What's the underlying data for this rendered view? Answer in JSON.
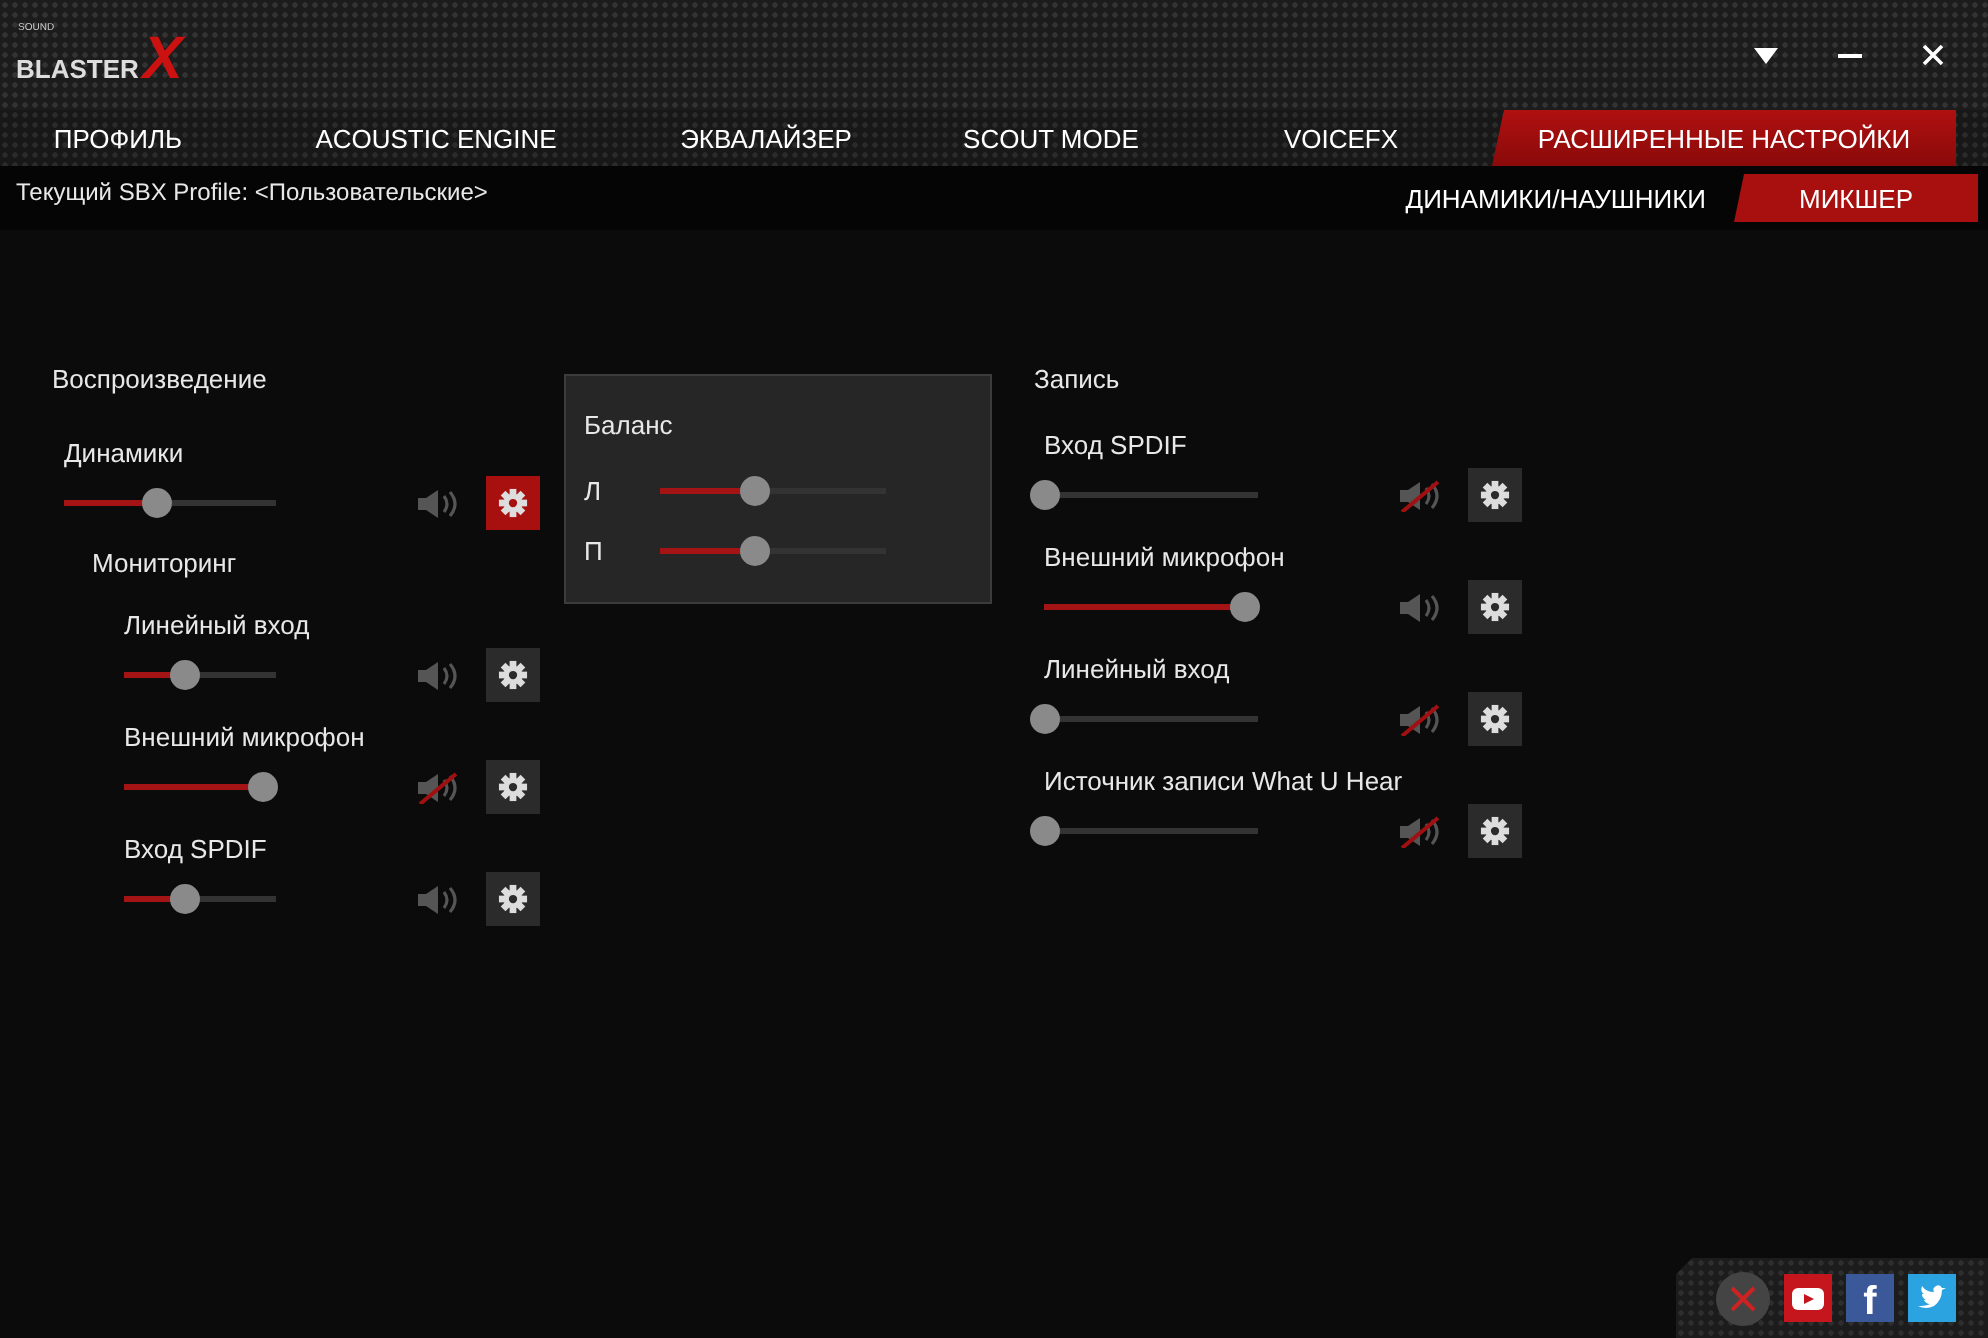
{
  "logo": {
    "small": "SOUND",
    "main": "BLASTER",
    "mark": "X"
  },
  "window_controls": [
    {
      "kind": "dropdown"
    },
    {
      "kind": "minimize"
    },
    {
      "kind": "close"
    }
  ],
  "tabs": [
    {
      "label": "ПРОФИЛЬ",
      "selected": false
    },
    {
      "label": "ACOUSTIC ENGINE",
      "selected": false
    },
    {
      "label": "ЭКВАЛАЙЗЕР",
      "selected": false
    },
    {
      "label": "SCOUT MODE",
      "selected": false
    },
    {
      "label": "VOICEFX",
      "selected": false
    },
    {
      "label": "РАСШИРЕННЫЕ НАСТРОЙКИ",
      "selected": true
    }
  ],
  "profile": "Текущий SBX Profile: <Пользовательские>",
  "subtabs": [
    {
      "label": "ДИНАМИКИ/НАУШНИКИ",
      "selected": false
    },
    {
      "label": "МИКШЕР",
      "selected": true
    }
  ],
  "playback": {
    "title": "Воспроизведение",
    "devices": [
      {
        "label": "Динамики",
        "level": 0.43,
        "muted": false,
        "settings_open": true
      }
    ],
    "monitoring": {
      "title": "Мониторинг",
      "devices": [
        {
          "label": "Линейный вход",
          "level": 0.39,
          "muted": false,
          "settings_open": false
        },
        {
          "label": "Внешний микрофон",
          "level": 0.91,
          "muted": true,
          "settings_open": false
        },
        {
          "label": "Вход SPDIF",
          "level": 0.39,
          "muted": false,
          "settings_open": false
        }
      ]
    }
  },
  "balance_popup": {
    "title": "Баланс",
    "channels": [
      {
        "label": "Л",
        "level": 0.42
      },
      {
        "label": "П",
        "level": 0.42
      }
    ]
  },
  "recording": {
    "title": "Запись",
    "devices": [
      {
        "label": "Вход SPDIF",
        "level": 0,
        "muted": true,
        "settings_open": false
      },
      {
        "label": "Внешний микрофон",
        "level": 0.93,
        "muted": false,
        "settings_open": false
      },
      {
        "label": "Линейный вход",
        "level": 0,
        "muted": true,
        "settings_open": false
      },
      {
        "label": "Источник записи What U Hear",
        "level": 0,
        "muted": true,
        "settings_open": false
      }
    ]
  },
  "social": [
    {
      "kind": "close"
    },
    {
      "kind": "youtube"
    },
    {
      "kind": "facebook",
      "label": "f"
    },
    {
      "kind": "twitter"
    }
  ]
}
